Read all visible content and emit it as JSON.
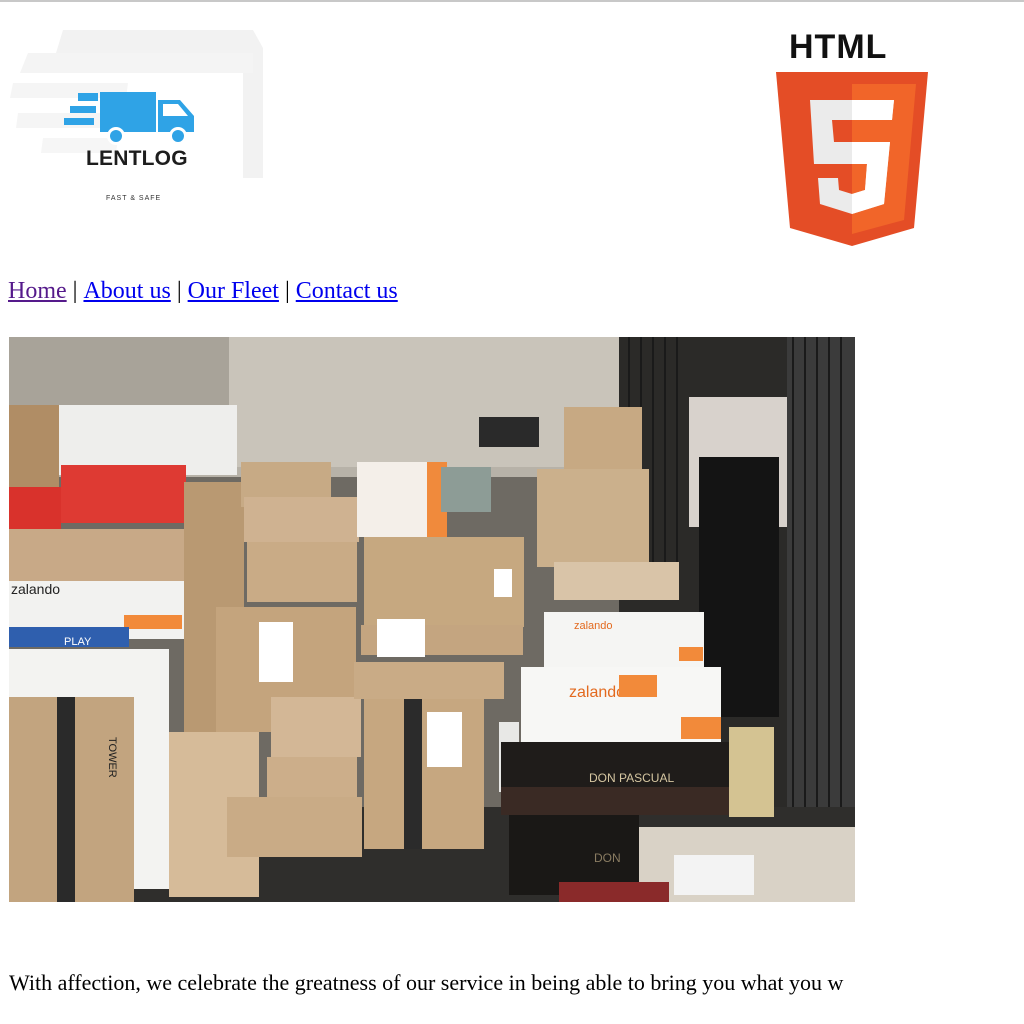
{
  "brand": {
    "name": "LENTLOG",
    "tagline": "FAST & SAFE"
  },
  "badge": {
    "word": "HTML",
    "number": "5"
  },
  "nav": {
    "items": [
      {
        "label": "Home"
      },
      {
        "label": "About us"
      },
      {
        "label": "Our Fleet"
      },
      {
        "label": "Contact us"
      }
    ],
    "separator": "|"
  },
  "photo": {
    "box_texts": {
      "zalando_1": "zalando",
      "zalando_2": "zalando",
      "zalando_3": "zalando",
      "play": "PLAY",
      "don_pascual_1": "DON PASCUAL",
      "don_pascual_2": "DON",
      "tower": "TOWER"
    }
  },
  "intro_text": "With affection, we celebrate the greatness of our service in being able to bring you what you w",
  "colors": {
    "link": "#0000ee",
    "visited_link": "#551a8b",
    "html5_orange": "#e44d26",
    "html5_light_orange": "#f16529",
    "truck_blue": "#2fa3e6"
  }
}
